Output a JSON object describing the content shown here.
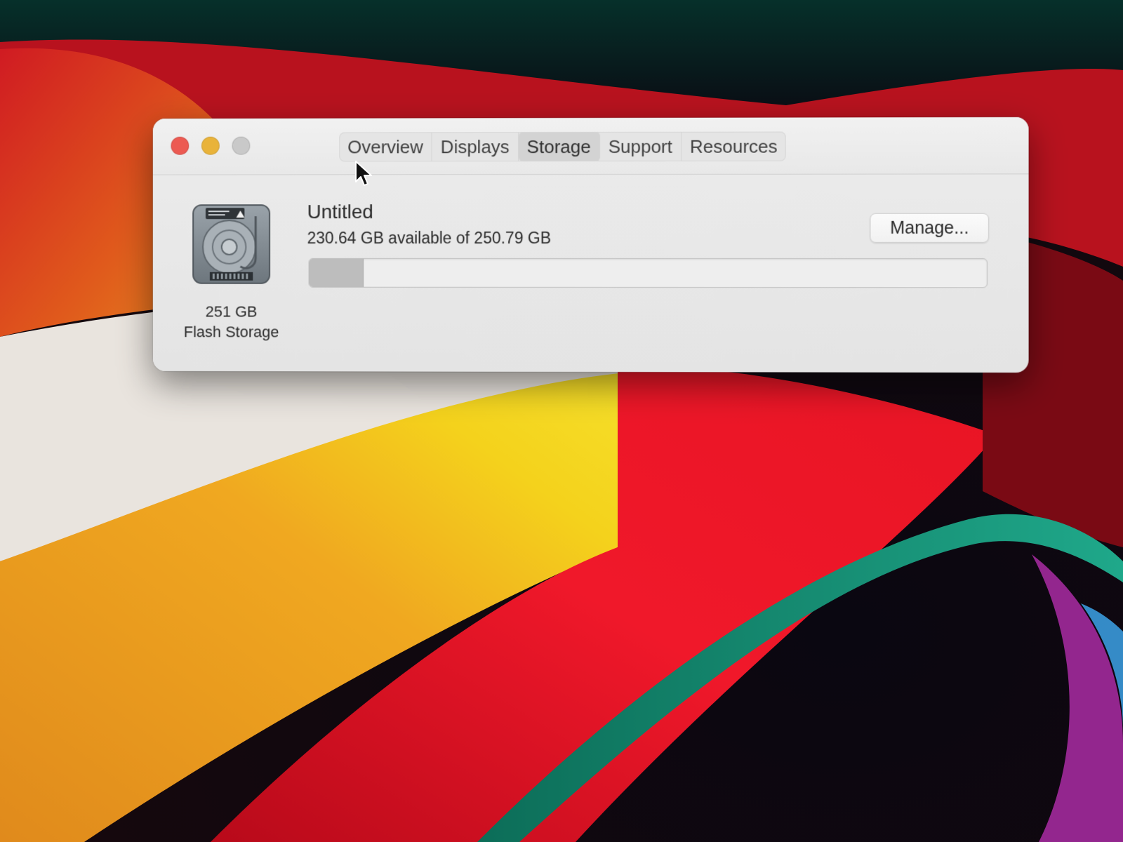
{
  "window": {
    "tabs": [
      {
        "label": "Overview",
        "active": false
      },
      {
        "label": "Displays",
        "active": false
      },
      {
        "label": "Storage",
        "active": true
      },
      {
        "label": "Support",
        "active": false
      },
      {
        "label": "Resources",
        "active": false
      }
    ]
  },
  "storage": {
    "drive_icon": "hard-drive-icon",
    "capacity_label": "251 GB",
    "type_label": "Flash Storage",
    "volume_name": "Untitled",
    "available_text": "230.64 GB available of 250.79 GB",
    "manage_label": "Manage...",
    "used_fraction": 0.08
  },
  "colors": {
    "close": "#ec5a52",
    "minimize": "#e9b33a",
    "maximize_disabled": "#c9c9c9"
  }
}
